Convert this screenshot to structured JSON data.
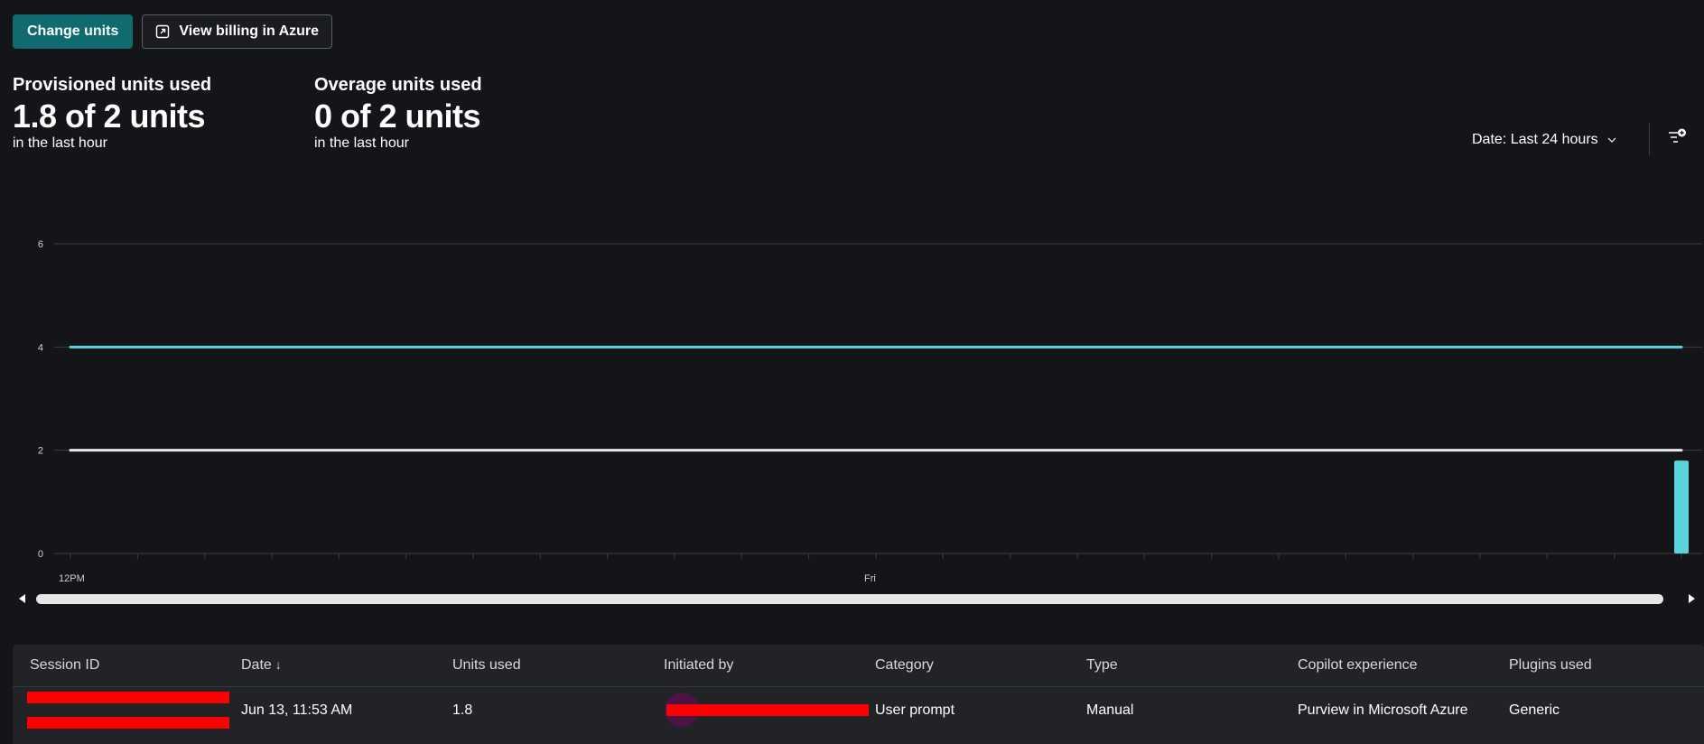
{
  "toolbar": {
    "change_units_label": "Change units",
    "view_billing_label": "View billing in Azure"
  },
  "kpis": {
    "provisioned": {
      "title": "Provisioned units used",
      "value": "1.8 of 2 units",
      "sub": "in the last hour"
    },
    "overage": {
      "title": "Overage units used",
      "value": "0 of 2 units",
      "sub": "in the last hour"
    }
  },
  "date_filter": {
    "label": "Date: Last 24 hours"
  },
  "colors": {
    "accent": "#0f6b6e",
    "series": "#5ad3dc",
    "baseline": "#e9e9e9",
    "redaction": "#ff0000"
  },
  "chart_data": {
    "type": "bar",
    "ylim": [
      0,
      6
    ],
    "yticks": [
      "0",
      "2",
      "4",
      "6"
    ],
    "xlabels": [
      {
        "label": "12PM",
        "pos": 0
      },
      {
        "label": "Fri",
        "pos": 12
      }
    ],
    "bucket_count": 24,
    "series": [
      {
        "name": "Units used",
        "values": [
          0,
          0,
          0,
          0,
          0,
          0,
          0,
          0,
          0,
          0,
          0,
          0,
          0,
          0,
          0,
          0,
          0,
          0,
          0,
          0,
          0,
          0,
          0,
          1.8
        ]
      }
    ],
    "reference_lines": [
      {
        "value": 4,
        "color": "#5ad3dc"
      },
      {
        "value": 2,
        "color": "#e9e9e9"
      }
    ],
    "grid": true
  },
  "table": {
    "columns": [
      "Session ID",
      "Date",
      "Units used",
      "Initiated by",
      "Category",
      "Type",
      "Copilot experience",
      "Plugins used"
    ],
    "rows": [
      {
        "session_id": "",
        "date": "Jun 13, 11:53 AM",
        "units": "1.8",
        "initiated_by": "",
        "category": "User prompt",
        "type": "Manual",
        "experience": "Purview in Microsoft Azure",
        "plugins": "Generic"
      }
    ]
  }
}
